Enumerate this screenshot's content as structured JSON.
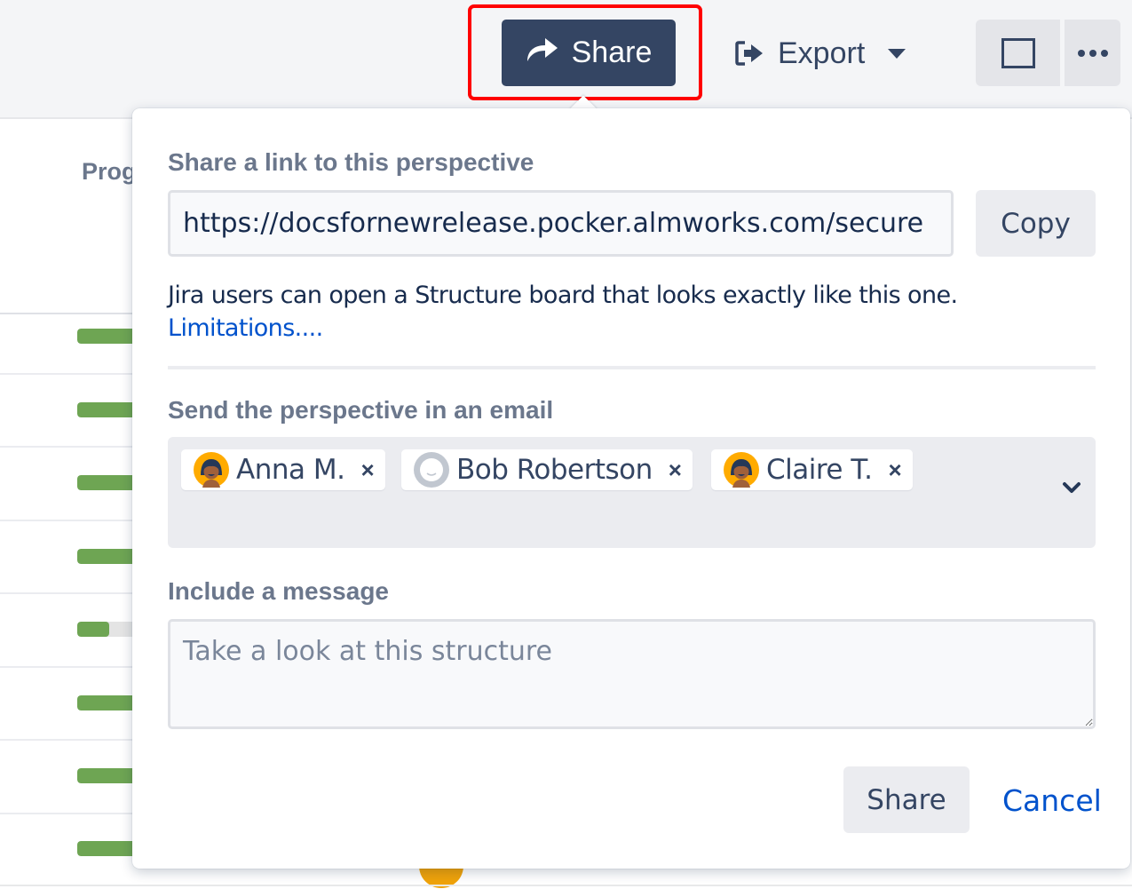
{
  "toolbar": {
    "share_label": "Share",
    "share_icon": "share-arrow-icon",
    "export_label": "Export",
    "export_icon": "export-icon",
    "export_caret_icon": "caret-down-icon",
    "fullscreen_icon": "square-icon",
    "more_icon": "ellipsis-icon",
    "highlight_color": "#ff0000",
    "share_button_color": "#344563"
  },
  "background_table": {
    "column_header": "Prog",
    "progress_rows": [
      {
        "progress": 1.0
      },
      {
        "progress": 1.0
      },
      {
        "progress": 1.0
      },
      {
        "progress": 1.0
      },
      {
        "progress": 0.3
      },
      {
        "progress": 1.0
      },
      {
        "progress": 1.0
      },
      {
        "progress": 1.0
      }
    ],
    "progress_color": "#6ea553"
  },
  "share_popup": {
    "link_section_label": "Share a link to this perspective",
    "link_value": "https://docsfornewrelease.pocker.almworks.com/secure",
    "copy_label": "Copy",
    "info_text": "Jira users can open a Structure board that looks exactly like this one.",
    "limitations_link": "Limitations....",
    "email_section_label": "Send the perspective in an email",
    "recipients": [
      {
        "name": "Anna M.",
        "avatar": "user-avatar-female"
      },
      {
        "name": "Bob Robertson",
        "avatar": "default-avatar"
      },
      {
        "name": "Claire T.",
        "avatar": "user-avatar-female"
      }
    ],
    "remove_glyph": "×",
    "message_section_label": "Include a message",
    "message_placeholder": "Take a look at this structure",
    "message_value": "",
    "share_label": "Share",
    "cancel_label": "Cancel",
    "link_color": "#0052cc"
  }
}
